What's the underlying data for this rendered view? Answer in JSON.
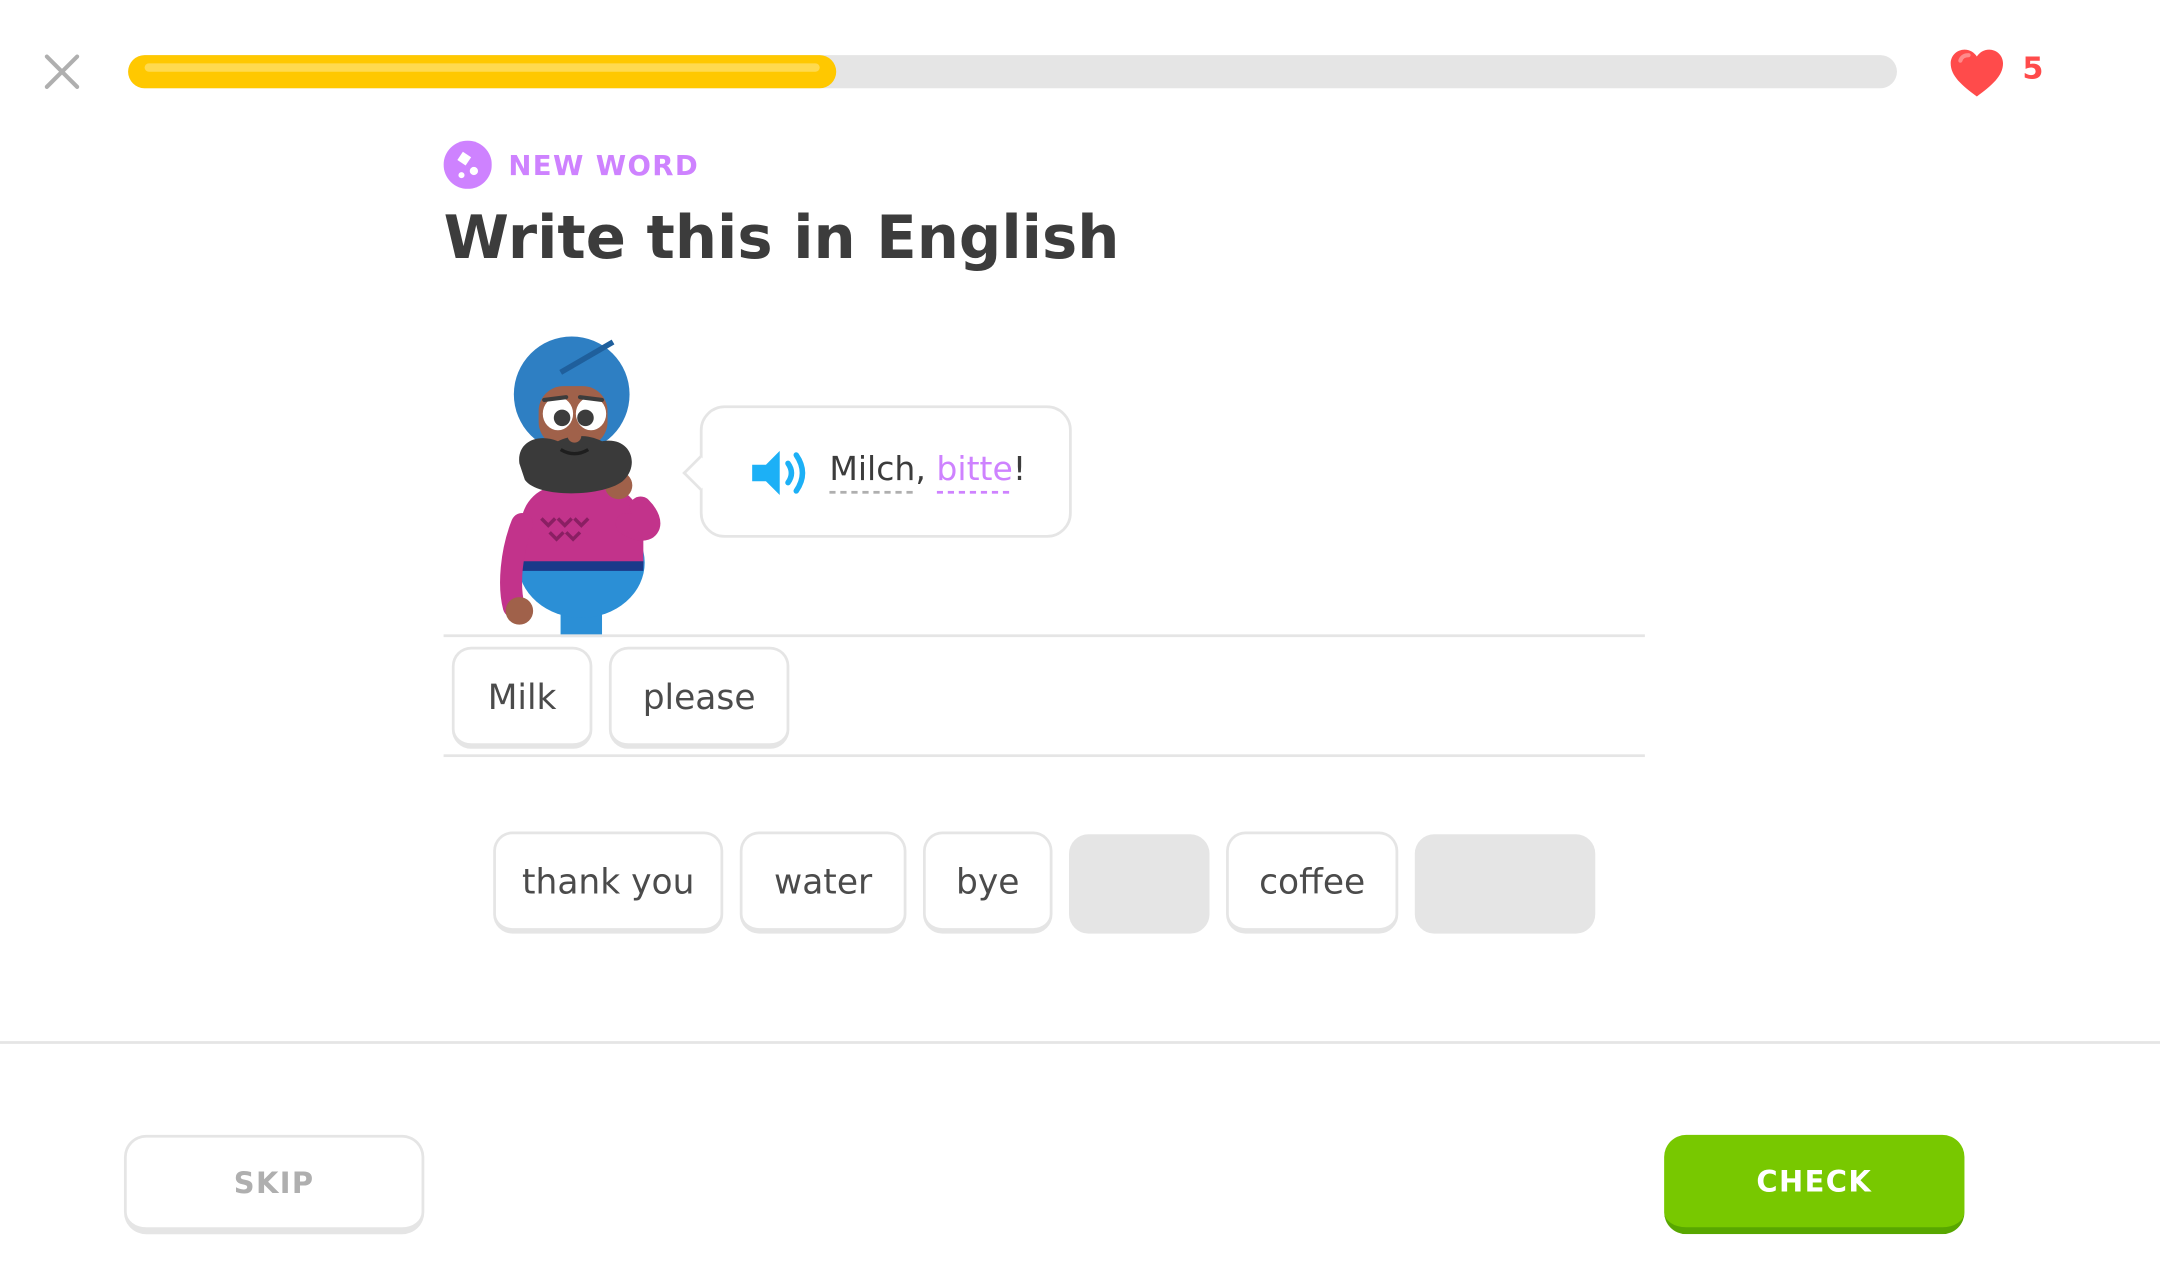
{
  "header": {
    "close_icon": "close-icon",
    "progress_fraction": 0.4,
    "hearts_icon": "heart-icon",
    "hearts": "5"
  },
  "challenge": {
    "badge_icon": "new-word-icon",
    "badge": "NEW WORD",
    "title": "Write this in English",
    "character": "turbaned-man-character",
    "speaker_icon": "speaker-icon",
    "prompt_tokens": [
      "Milch",
      ",",
      "bitte",
      "!"
    ],
    "new_word": "bitte"
  },
  "answer": {
    "selected": [
      "Milk",
      "please"
    ]
  },
  "word_bank": [
    {
      "label": "thank you",
      "used": false
    },
    {
      "label": "water",
      "used": false
    },
    {
      "label": "bye",
      "used": false
    },
    {
      "label": "",
      "used": true
    },
    {
      "label": "coffee",
      "used": false
    },
    {
      "label": "",
      "used": true
    }
  ],
  "footer": {
    "skip": "SKIP",
    "check": "CHECK"
  },
  "colors": {
    "progress": "#ffc800",
    "accent_purple": "#ce82ff",
    "heart": "#ff4b4b",
    "check": "#78c800",
    "border": "#e5e5e5"
  }
}
